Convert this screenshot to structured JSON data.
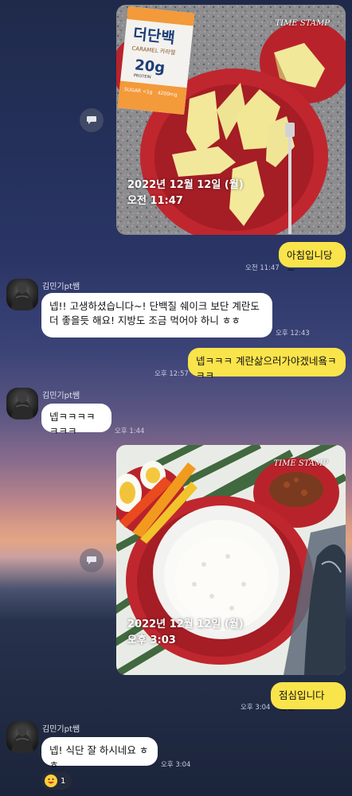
{
  "chat": {
    "photo1": {
      "date_line": "2022년 12월 12일 (월)",
      "time_line": "오전 11:47",
      "brand": "TIME STAMP",
      "package_brand": "더단백",
      "package_flavor": "CARAMEL 카라멜",
      "package_protein": "20g",
      "package_protein_label": "PROTEIN",
      "package_sugar": "SUGAR <1g",
      "package_volume": "4200mg"
    },
    "msg1": {
      "text": "아침입니당~",
      "time": "오전 11:47"
    },
    "sender1": {
      "name": "김민기pt쌤"
    },
    "msg2": {
      "text": "넵!! 고생하셨습니다~! 단백질 쉐이크 보단 계란도 더 좋을듯 해요! 지방도 조금 먹어야 하니 ㅎㅎ",
      "time": "오후 12:43"
    },
    "msg3": {
      "text": "넵ㅋㅋㅋ 계란삶으러가야겠네욬ㅋㅋㅋ",
      "time": "오후 12:57"
    },
    "sender2": {
      "name": "김민기pt쌤"
    },
    "msg4": {
      "text": "넵ㅋㅋㅋㅋㅋㅋㅋ",
      "time": "오후 1:44"
    },
    "photo2": {
      "date_line": "2022년 12월 12일 (월)",
      "time_line": "오후 3:03",
      "brand": "TIME STAMP"
    },
    "msg5": {
      "text": "점심입니다~~",
      "time": "오후 3:04"
    },
    "sender3": {
      "name": "김민기pt쌤"
    },
    "msg6": {
      "text": "넵! 식단 잘 하시네요 ㅎㅎ",
      "time": "오후 3:04"
    },
    "reaction": {
      "count": "1"
    }
  },
  "colors": {
    "my_bubble": "#fae44b",
    "their_bubble": "#ffffff",
    "plate_red": "#c0262e"
  },
  "icons": {
    "share": "share-icon",
    "reaction": "grinning-face-emoji"
  }
}
